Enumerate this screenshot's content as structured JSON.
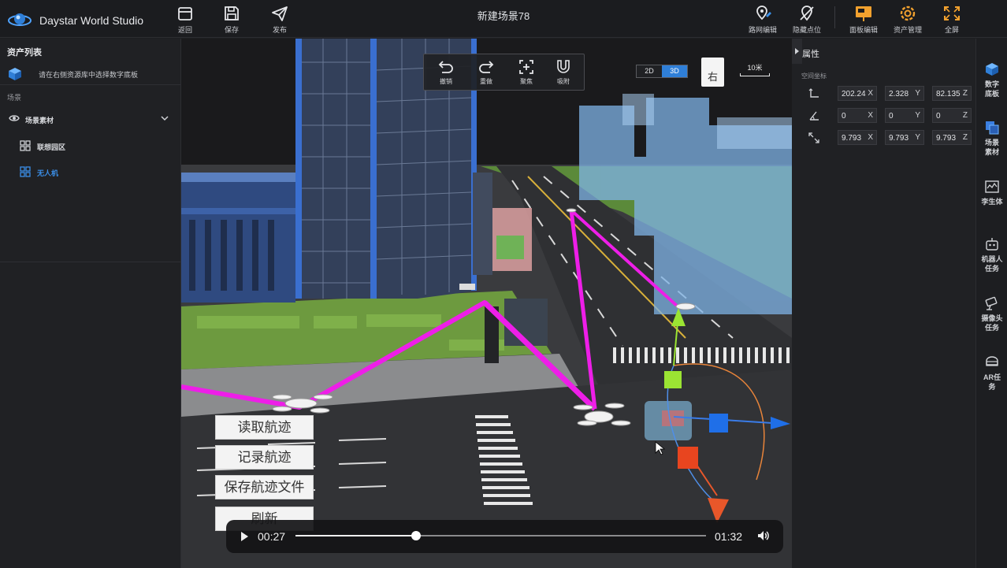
{
  "app": {
    "title": "Daystar World Studio",
    "scene_title": "新建场景78"
  },
  "toolbar_left": [
    {
      "label": "返回",
      "icon": "back-icon"
    },
    {
      "label": "保存",
      "icon": "save-icon"
    },
    {
      "label": "发布",
      "icon": "publish-icon"
    }
  ],
  "toolbar_right": [
    {
      "label": "路网编辑",
      "icon": "route-edit-icon"
    },
    {
      "label": "隐藏点位",
      "icon": "hide-points-icon"
    },
    {
      "label": "面板编辑",
      "icon": "panel-edit-icon"
    },
    {
      "label": "资产管理",
      "icon": "asset-manage-icon"
    },
    {
      "label": "全屏",
      "icon": "fullscreen-icon"
    }
  ],
  "left_panel": {
    "heading": "资产列表",
    "hint": "请在右侧资源库中选择数字底板",
    "section": "场景",
    "tree": [
      {
        "label": "场景素材",
        "icon": "eye-icon",
        "expanded": true
      },
      {
        "label": "联想园区",
        "icon": "grid-icon"
      },
      {
        "label": "无人机",
        "icon": "grid-icon",
        "active": true
      }
    ]
  },
  "viewport": {
    "tools": [
      {
        "label": "撤销",
        "icon": "undo-icon"
      },
      {
        "label": "重做",
        "icon": "redo-icon"
      },
      {
        "label": "聚焦",
        "icon": "focus-icon"
      },
      {
        "label": "吸附",
        "icon": "magnet-icon"
      }
    ],
    "dim_toggle": {
      "option_2d": "2D",
      "option_3d": "3D",
      "selected": "3D"
    },
    "view_cube_face": "右",
    "scale_label": "10米",
    "track_buttons": [
      "读取航迹",
      "记录航迹",
      "保存航迹文件",
      "刷新"
    ],
    "player": {
      "current_time": "00:27",
      "total_time": "01:32",
      "progress": 0.293
    }
  },
  "properties": {
    "title": "属性",
    "subtitle": "空间坐标",
    "rows": [
      {
        "icon": "position-icon",
        "x": "202.24",
        "y": "2.328",
        "z": "82.135"
      },
      {
        "icon": "rotation-icon",
        "x": "0",
        "y": "0",
        "z": "0"
      },
      {
        "icon": "scale-icon",
        "x": "9.793",
        "y": "9.793",
        "z": "9.793"
      }
    ],
    "axis_labels": [
      "X",
      "Y",
      "Z"
    ]
  },
  "right_sidebar": [
    {
      "label": "数字底板",
      "icon": "digital-base-icon"
    },
    {
      "label": "场景素材",
      "icon": "scene-assets-icon"
    },
    {
      "label": "李生体",
      "icon": "twin-icon"
    },
    {
      "label": "机器人任务",
      "icon": "robot-task-icon"
    },
    {
      "label": "摄像头任务",
      "icon": "camera-task-icon"
    },
    {
      "label": "AR任务",
      "icon": "ar-task-icon"
    }
  ],
  "colors": {
    "accent": "#2f7fd8",
    "flight_path": "#ee1ee8",
    "gizmo_y": "#9be433",
    "gizmo_z": "#1f6fe8",
    "gizmo_x": "#e8572a"
  }
}
